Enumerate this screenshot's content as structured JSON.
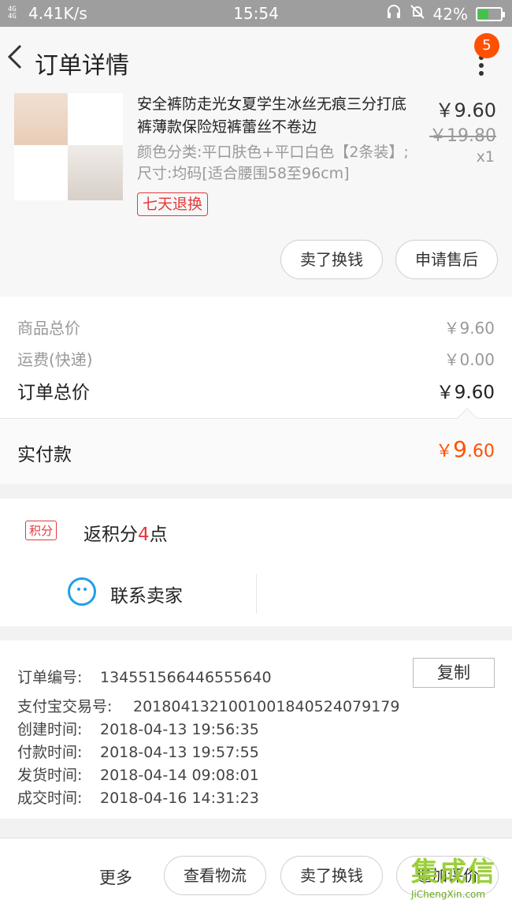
{
  "status_bar": {
    "signal": "4G 4G",
    "speed": "4.41K/s",
    "time": "15:54",
    "battery": "42%",
    "battery_level": 0.42
  },
  "header": {
    "title": "订单详情",
    "badge_count": "5"
  },
  "product": {
    "name": "安全裤防走光女夏学生冰丝无痕三分打底裤薄款保险短裤蕾丝不卷边",
    "sku": "颜色分类:平口肤色+平口白色【2条装】;尺寸:均码[适合腰围58至96cm]",
    "tag": "七天退换",
    "price": "￥9.60",
    "original_price": "￥19.80",
    "quantity": "x1",
    "buttons": {
      "sell": "卖了换钱",
      "after_sale": "申请售后"
    }
  },
  "totals": {
    "goods_label": "商品总价",
    "goods_value": "￥9.60",
    "shipping_label": "运费(快递)",
    "shipping_value": "￥0.00",
    "order_total_label": "订单总价",
    "order_total_value": "￥9.60",
    "paid_label": "实付款",
    "paid_currency": "￥",
    "paid_int": "9",
    "paid_dec": ".60"
  },
  "points": {
    "tag": "积分",
    "text_prefix": "返积分",
    "count": "4",
    "text_suffix": "点"
  },
  "contact": {
    "label": "联系卖家"
  },
  "order_info": {
    "copy_label": "复制",
    "rows": [
      {
        "key": "订单编号:",
        "value": "134551566446555640"
      },
      {
        "key": "支付宝交易号:",
        "value": "2018041321001001840524079179"
      },
      {
        "key": "创建时间:",
        "value": "2018-04-13 19:56:35"
      },
      {
        "key": "付款时间:",
        "value": "2018-04-13 19:57:55"
      },
      {
        "key": "发货时间:",
        "value": "2018-04-14 09:08:01"
      },
      {
        "key": "成交时间:",
        "value": "2018-04-16 14:31:23"
      }
    ]
  },
  "bottom_bar": {
    "more": "更多",
    "logistics": "查看物流",
    "sell": "卖了换钱",
    "review": "追加评价"
  },
  "watermark": {
    "main": "集成信",
    "sub": "JiChengXin.com"
  },
  "colors": {
    "accent": "#ff5000",
    "red": "#e4393c",
    "blue": "#1fa0e8"
  }
}
